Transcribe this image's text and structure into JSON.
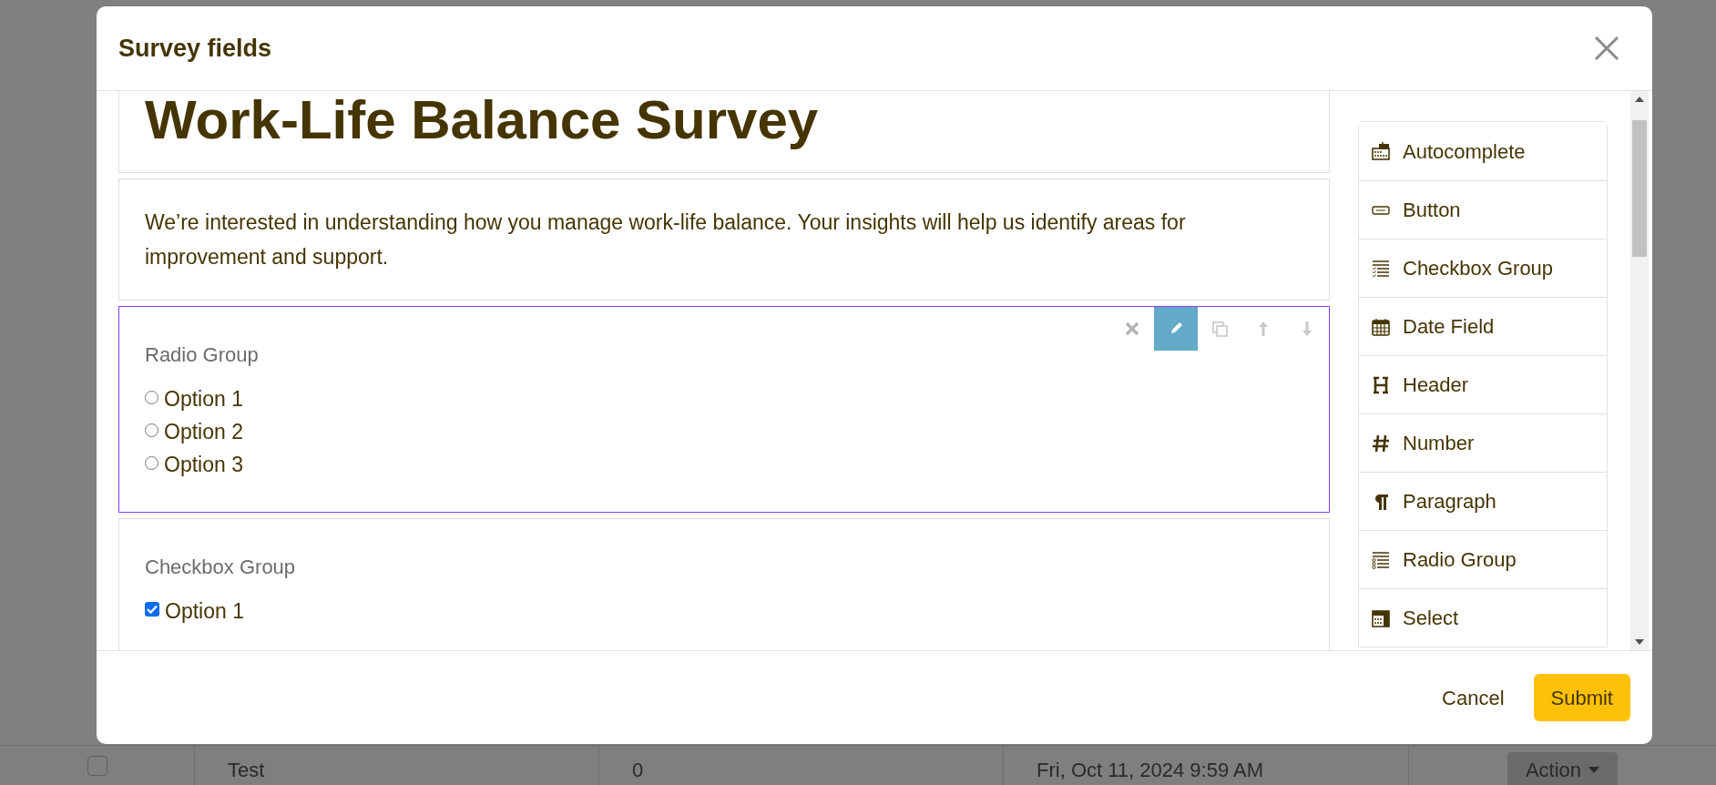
{
  "background_row": {
    "checked": false,
    "cells": [
      "Test",
      "0",
      "Fri, Oct 11, 2024 9:59 AM"
    ],
    "action": "Action"
  },
  "modal": {
    "title": "Survey fields",
    "fields": [
      {
        "kind": "header",
        "text": "Work-Life Balance Survey",
        "selected": false
      },
      {
        "kind": "paragraph",
        "text": "We’re interested in understanding how you manage work-life balance. Your insights will help us identify areas for improvement and support.",
        "selected": false
      },
      {
        "kind": "radio-group",
        "label": "Radio Group",
        "selected": true,
        "options": [
          {
            "label": "Option 1",
            "checked": false
          },
          {
            "label": "Option 2",
            "checked": false
          },
          {
            "label": "Option 3",
            "checked": false
          }
        ]
      },
      {
        "kind": "checkbox-group",
        "label": "Checkbox Group",
        "selected": false,
        "options": [
          {
            "label": "Option 1",
            "checked": true
          }
        ]
      }
    ],
    "field_types": [
      {
        "kind": "autocomplete",
        "label": "Autocomplete"
      },
      {
        "kind": "button",
        "label": "Button"
      },
      {
        "kind": "checkbox-group",
        "label": "Checkbox Group"
      },
      {
        "kind": "date",
        "label": "Date Field"
      },
      {
        "kind": "header",
        "label": "Header"
      },
      {
        "kind": "number",
        "label": "Number"
      },
      {
        "kind": "paragraph",
        "label": "Paragraph"
      },
      {
        "kind": "radio-group",
        "label": "Radio Group"
      },
      {
        "kind": "select",
        "label": "Select"
      }
    ],
    "buttons": [
      {
        "kind": "cancel",
        "label": "Cancel"
      },
      {
        "kind": "submit",
        "label": "Submit"
      }
    ]
  }
}
